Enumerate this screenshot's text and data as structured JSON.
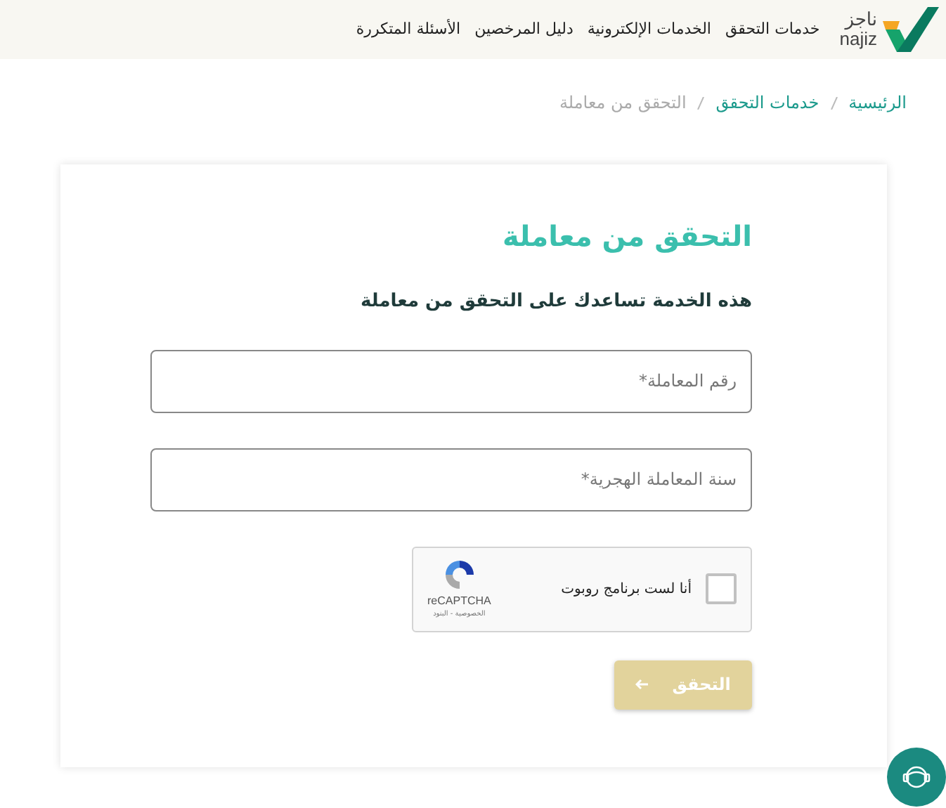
{
  "header": {
    "logo": {
      "arabic": "ناجز",
      "latin": "najiz"
    },
    "nav": [
      "خدمات التحقق",
      "الخدمات الإلكترونية",
      "دليل المرخصين",
      "الأسئلة المتكررة"
    ]
  },
  "breadcrumb": [
    {
      "label": "الرئيسية",
      "current": false
    },
    {
      "label": "خدمات التحقق",
      "current": false
    },
    {
      "label": "التحقق من معاملة",
      "current": true
    }
  ],
  "form": {
    "title": "التحقق من معاملة",
    "subtitle": "هذه الخدمة تساعدك على التحقق من معاملة",
    "fields": [
      {
        "placeholder": "رقم المعاملة*"
      },
      {
        "placeholder": "سنة المعاملة الهجرية*"
      }
    ],
    "captcha": {
      "label": "أنا لست برنامج روبوت",
      "checked": false,
      "brand": "reCAPTCHA",
      "links": "الخصوصية - البنود"
    },
    "submit": {
      "label": "التحقق",
      "disabled": true
    }
  }
}
